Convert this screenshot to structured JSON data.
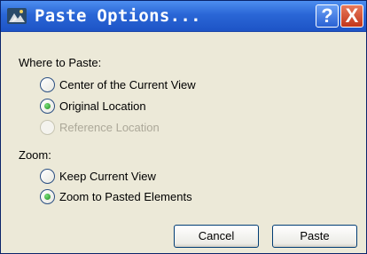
{
  "window": {
    "title": "Paste Options...",
    "help_label": "?",
    "close_label": "X"
  },
  "where_group": {
    "label": "Where to Paste:",
    "options": [
      {
        "label": "Center of the Current View",
        "selected": false,
        "enabled": true
      },
      {
        "label": "Original Location",
        "selected": true,
        "enabled": true
      },
      {
        "label": "Reference Location",
        "selected": false,
        "enabled": false
      }
    ]
  },
  "zoom_group": {
    "label": "Zoom:",
    "options": [
      {
        "label": "Keep Current View",
        "selected": false,
        "enabled": true
      },
      {
        "label": "Zoom to Pasted Elements",
        "selected": true,
        "enabled": true
      }
    ]
  },
  "buttons": {
    "cancel": "Cancel",
    "paste": "Paste"
  },
  "colors": {
    "titlebar": "#2a66d6",
    "dialog_bg": "#ece9d8",
    "radio_selected": "#1f8a1f"
  }
}
